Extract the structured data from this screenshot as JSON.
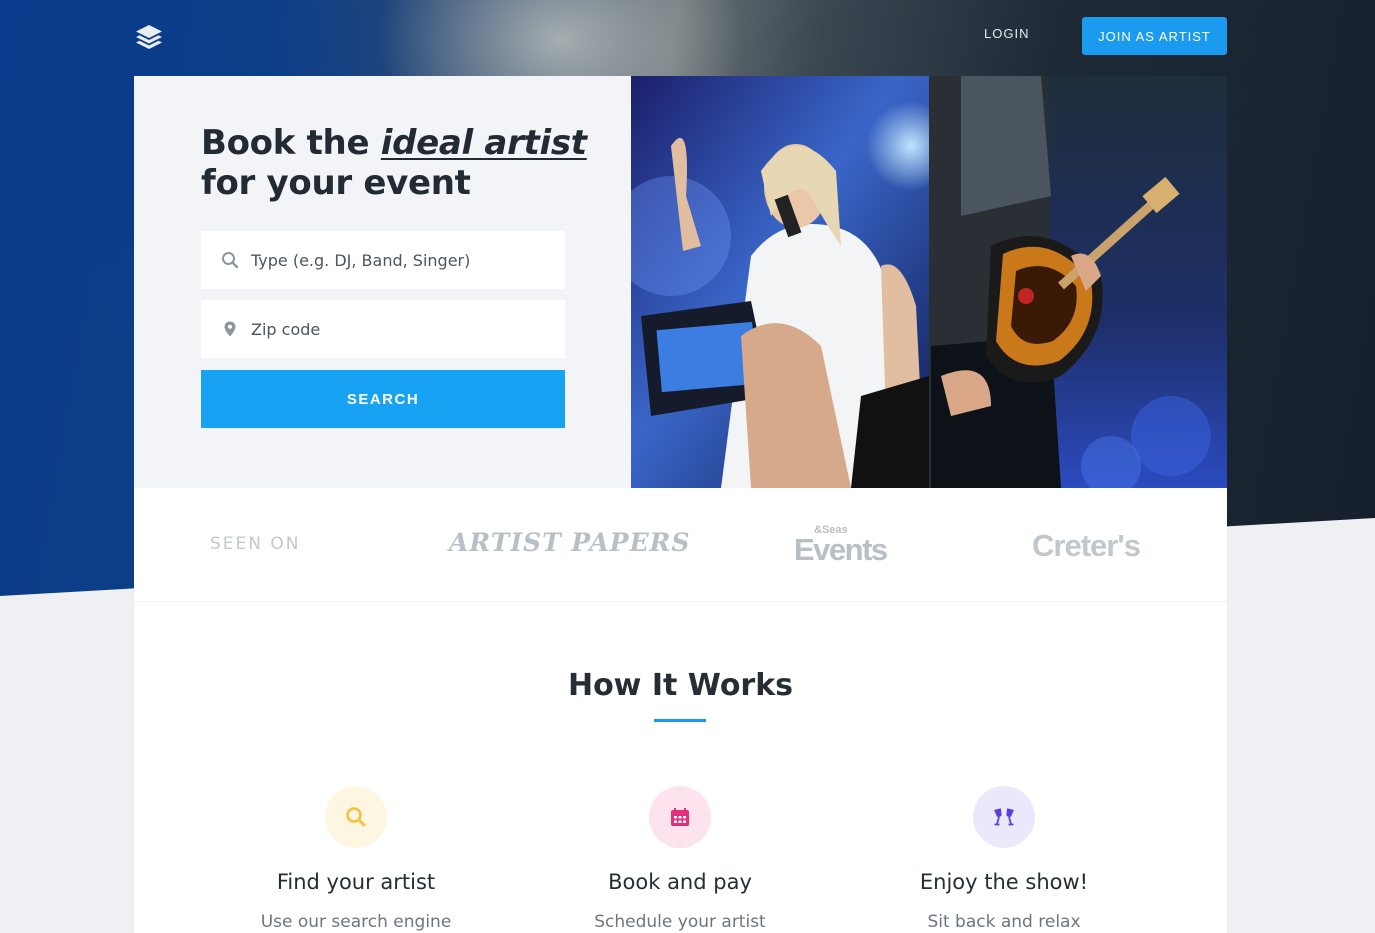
{
  "header": {
    "login_label": "LOGIN",
    "join_label": "JOIN AS ARTIST",
    "logo_icon": "layers-icon"
  },
  "hero": {
    "headline_pre": "Book the ",
    "headline_em": "ideal artist",
    "headline_post": "for your event",
    "type_placeholder": "Type (e.g. DJ, Band, Singer)",
    "zip_placeholder": "Zip code",
    "search_label": "SEARCH"
  },
  "seen_on": {
    "label": "SEEN ON",
    "logos": [
      "ARTIST PAPERS",
      "&Seas",
      "Events",
      "Creter's"
    ]
  },
  "how_it_works": {
    "title": "How It Works",
    "steps": [
      {
        "title": "Find your artist",
        "desc": "Use our search engine",
        "icon": "search-icon",
        "color": "#f5c242"
      },
      {
        "title": "Book and pay",
        "desc": "Schedule your artist",
        "icon": "calendar-icon",
        "color": "#e0307a"
      },
      {
        "title": "Enjoy the show!",
        "desc": "Sit back and relax",
        "icon": "cheers-icon",
        "color": "#5b3fd6"
      }
    ]
  },
  "colors": {
    "accent": "#1a9bf0",
    "hero_dark": "#0a3a8c"
  }
}
